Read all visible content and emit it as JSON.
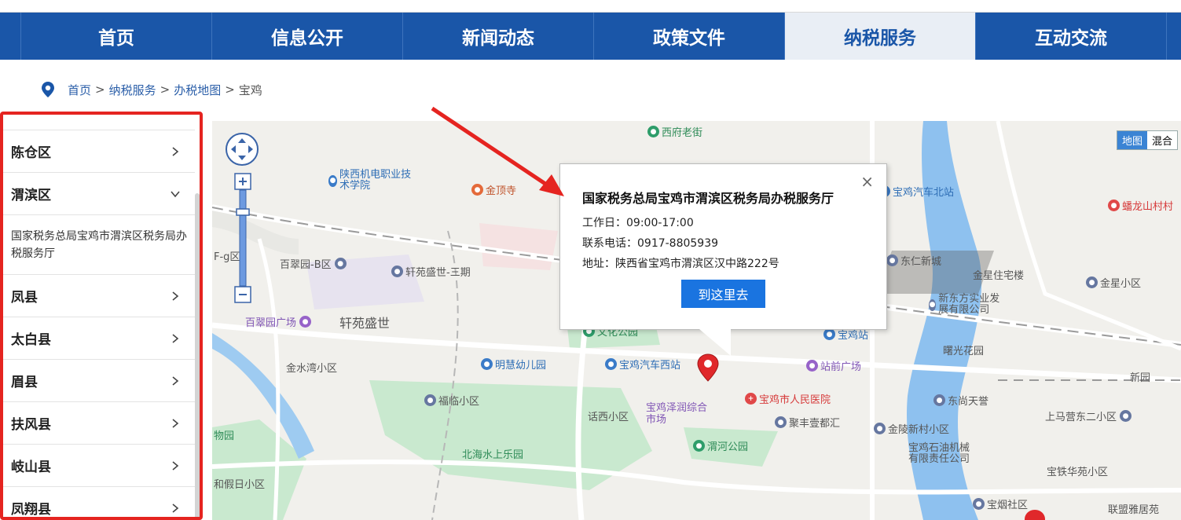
{
  "nav": {
    "items": [
      {
        "label": "首页"
      },
      {
        "label": "信息公开"
      },
      {
        "label": "新闻动态"
      },
      {
        "label": "政策文件"
      },
      {
        "label": "纳税服务",
        "active": true
      },
      {
        "label": "互动交流"
      }
    ]
  },
  "breadcrumb": {
    "home": "首页",
    "sep": ">",
    "level1": "纳税服务",
    "level2": "办税地图",
    "current": "宝鸡"
  },
  "sidebar": {
    "items": [
      {
        "label": "陈仓区",
        "expanded": false
      },
      {
        "label": "渭滨区",
        "expanded": true
      },
      {
        "label": "凤县",
        "expanded": false
      },
      {
        "label": "太白县",
        "expanded": false
      },
      {
        "label": "眉县",
        "expanded": false
      },
      {
        "label": "扶风县",
        "expanded": false
      },
      {
        "label": "岐山县",
        "expanded": false
      },
      {
        "label": "凤翔县",
        "expanded": false
      }
    ],
    "sub_item": "国家税务总局宝鸡市渭滨区税务局办税服务厅"
  },
  "map": {
    "type_map": "地图",
    "type_hybrid": "混合",
    "pois": {
      "p1": "西府老街",
      "p2": "陕西机电职业技术学院",
      "p3": "金顶寺",
      "p4": "宝鸡汽车北站",
      "p5": "蟠龙山村村",
      "p6": "东仁新城",
      "p7": "金星住宅楼",
      "p8": "金星小区",
      "p9": "百翠园-B区",
      "p10": "轩苑盛世-三期",
      "p11": "新东方实业发展有限公司",
      "p12": "百翠园广场",
      "p13": "轩苑盛世",
      "p14": "宝鸡站",
      "p15": "曙光花园",
      "p16": "金水湾小区",
      "p17": "明慧幼儿园",
      "p18": "宝鸡汽车西站",
      "p19": "站前广场",
      "p20": "新园",
      "p21": "福临小区",
      "p22": "宝鸡市人民医院",
      "p23": "东尚天誉",
      "p24": "话西小区",
      "p25": "宝鸡泽润综合市场",
      "p26": "聚丰壹都汇",
      "p27": "金陵新村小区",
      "p28": "上马营东二小区",
      "p29": "北海水上乐园",
      "p30": "渭河公园",
      "p31": "宝鸡石油机械有限责任公司",
      "p32": "宝铁华苑小区",
      "p33": "宝烟社区",
      "p34": "联盟雅居苑",
      "p35": "和假日小区",
      "p36": "物园",
      "p37": "F-g区",
      "p38": "文化公园"
    }
  },
  "popup": {
    "title": "国家税务总局宝鸡市渭滨区税务局办税服务厅",
    "hours": "工作日：09:00-17:00",
    "phone": "联系电话：0917-8805939",
    "address": "地址：陕西省宝鸡市渭滨区汉中路222号",
    "button": "到这里去",
    "close": "×"
  },
  "colors": {
    "nav_bg": "#1a56a8",
    "nav_active_bg": "#e9eef5",
    "highlight_border": "#e52420",
    "button_blue": "#1a74e0"
  }
}
